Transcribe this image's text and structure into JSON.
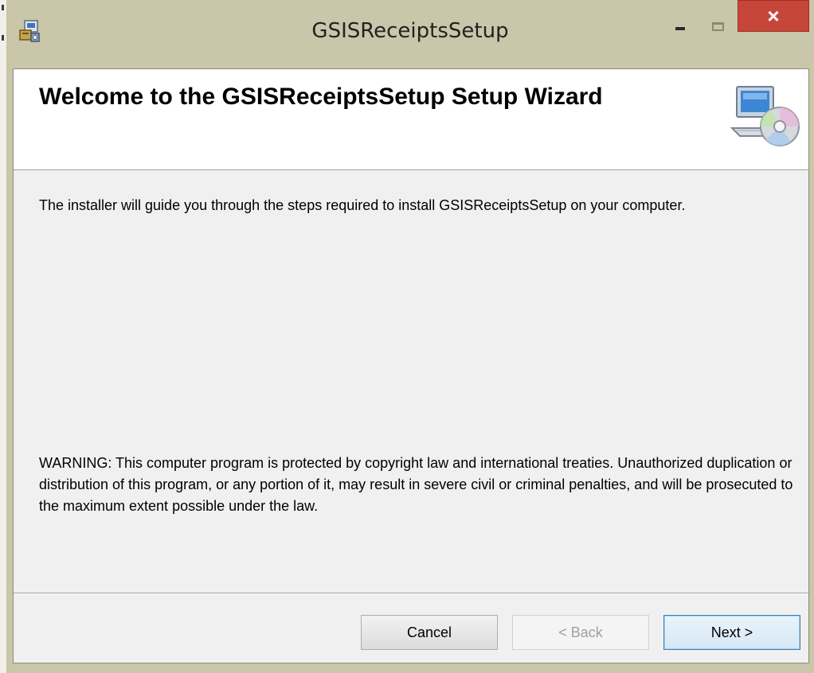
{
  "window": {
    "title": "GSISReceiptsSetup",
    "close_glyph": "×",
    "icons": {
      "app": "installer-icon",
      "minimize": "minimize-icon",
      "maximize": "maximize-icon",
      "close": "close-icon"
    }
  },
  "banner": {
    "title": "Welcome to the GSISReceiptsSetup Setup Wizard",
    "graphic_icon": "computer-cd-icon"
  },
  "body": {
    "intro": "The installer will guide you through the steps required to install GSISReceiptsSetup on your computer.",
    "warning": "WARNING: This computer program is protected by copyright law and international treaties. Unauthorized duplication or distribution of this program, or any portion of it, may result in severe civil or criminal penalties, and will be prosecuted to the maximum extent possible under the law."
  },
  "buttons": {
    "cancel": "Cancel",
    "back": "< Back",
    "next": "Next >"
  },
  "colors": {
    "frame": "#c9c6a9",
    "close_button": "#c7463a",
    "client_bg": "#f0f0f0",
    "banner_bg": "#ffffff",
    "focus_border": "#3c7fb1"
  }
}
